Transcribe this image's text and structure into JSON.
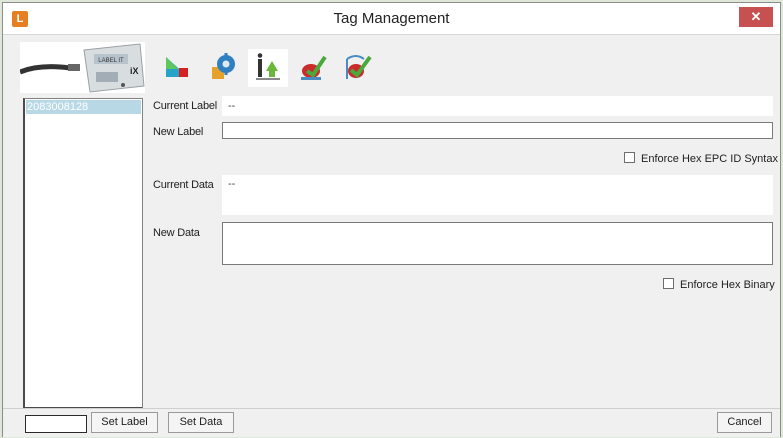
{
  "window": {
    "title": "Tag Management",
    "close_glyph": "✕",
    "app_icon": "logo-icon",
    "app_icon_text": "L"
  },
  "thumbnail": {
    "icon": "device-photo",
    "device_text": "LABEL IT",
    "device_suffix": "iX"
  },
  "toolbar": {
    "items": [
      {
        "name": "flag-icon"
      },
      {
        "name": "settings-gear-icon"
      },
      {
        "name": "upload-info-icon",
        "selected": true
      },
      {
        "name": "write-tag-icon"
      },
      {
        "name": "write-data-icon"
      }
    ]
  },
  "tag_list": {
    "items": [
      "2083008128"
    ]
  },
  "form": {
    "current_label": {
      "label": "Current Label",
      "value": "--"
    },
    "new_label": {
      "label": "New Label",
      "value": ""
    },
    "enforce_hex_epc": {
      "label": "Enforce Hex EPC ID Syntax",
      "checked": false
    },
    "current_data": {
      "label": "Current Data",
      "value": "--"
    },
    "new_data": {
      "label": "New Data",
      "value": ""
    },
    "enforce_hex_binary": {
      "label": "Enforce Hex Binary",
      "checked": false
    }
  },
  "footer": {
    "input_value": "",
    "set_label": "Set Label",
    "set_data": "Set Data",
    "cancel": "Cancel"
  },
  "colors": {
    "close": "#c75050",
    "selection": "#b8d8e6",
    "background": "#f0f0f0"
  }
}
